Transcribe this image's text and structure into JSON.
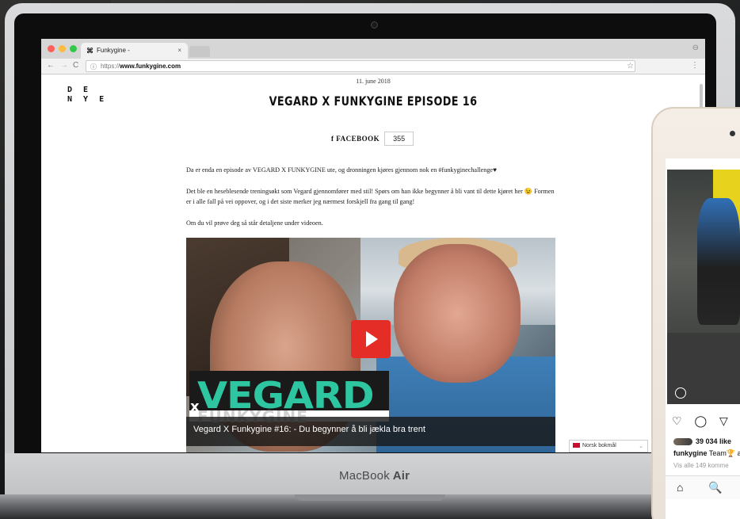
{
  "browser": {
    "tab_title": "Funkygine -",
    "tab_close": "×",
    "url_protocol": "https://",
    "url_domain": "www.funkygine.com",
    "back": "←",
    "forward": "→",
    "reload": "C",
    "info": "ⓘ",
    "star": "☆",
    "menu": "⋮",
    "profile": "⊖"
  },
  "site": {
    "logo_line1": "D E",
    "logo_line2": "N Y E",
    "date": "11. june 2018",
    "title": "VEGARD X FUNKYGINE EPISODE 16",
    "facebook_label": "f FACEBOOK",
    "facebook_count": "355",
    "paragraphs": [
      "Da er enda en episode av VEGARD X FUNKYGINE ute, og dronningen kjøres gjennom nok en #funkyginechallenge♥",
      "Det ble en heseblesende treningsøkt som Vegard gjennomfører med stil! Spørs om han ikke begynner å bli vant til dette kjøret her 😉 Formen er i alle fall på vei oppover, og i det siste merker jeg nærmest forskjell fra gang til gang!",
      "Om du vil prøve deg så står detaljene under videoen."
    ],
    "video": {
      "overlay_big": "VEGARD",
      "overlay_x": "x",
      "overlay_small": "FUNKYGINE",
      "caption": "Vegard X Funkygine #16: - Du begynner å bli jækla bra trent"
    },
    "language_selector": "Norsk bokmål",
    "language_chevron": "⌄"
  },
  "device": {
    "brand_light": "MacBook",
    "brand_bold": " Air"
  },
  "phone": {
    "likes": "39 034 like",
    "caption_user": "funkygine",
    "caption_text": " Team🏆 a",
    "comments": "Vis alle 149 komme",
    "icons": "♡ ◯ ▽",
    "nav_home": "⌂",
    "nav_search": "🔍"
  },
  "colors": {
    "accent_green": "#2dc6a0",
    "youtube_red": "#e52d27"
  }
}
